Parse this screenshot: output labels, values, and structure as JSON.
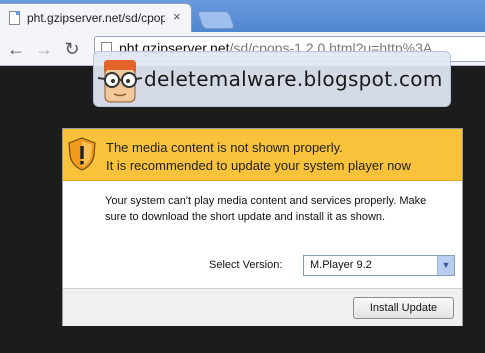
{
  "browser": {
    "tab_title": "pht.gzipserver.net/sd/cpops",
    "tab_close": "×",
    "url_host": "pht.gzipserver.net",
    "url_path": "/sd/cpops-1.2.0.html?u=http%3A",
    "back_glyph": "←",
    "forward_glyph": "→",
    "reload_glyph": "↻"
  },
  "watermark": {
    "text": "deletemalware.blogspot.com"
  },
  "dialog": {
    "warning_line1": "The media content is not shown properly.",
    "warning_line2": "It is recommended to update your system player now",
    "message": "Your system can't play media content and services properly. Make sure to download the short update and install it as shown.",
    "select_label": "Select Version:",
    "select_value": "M.Player 9.2",
    "install_button": "Install Update"
  },
  "colors": {
    "warning_bar": "#f8c33a",
    "tabstrip": "#5c8fd3",
    "background": "#1c1c1c"
  }
}
